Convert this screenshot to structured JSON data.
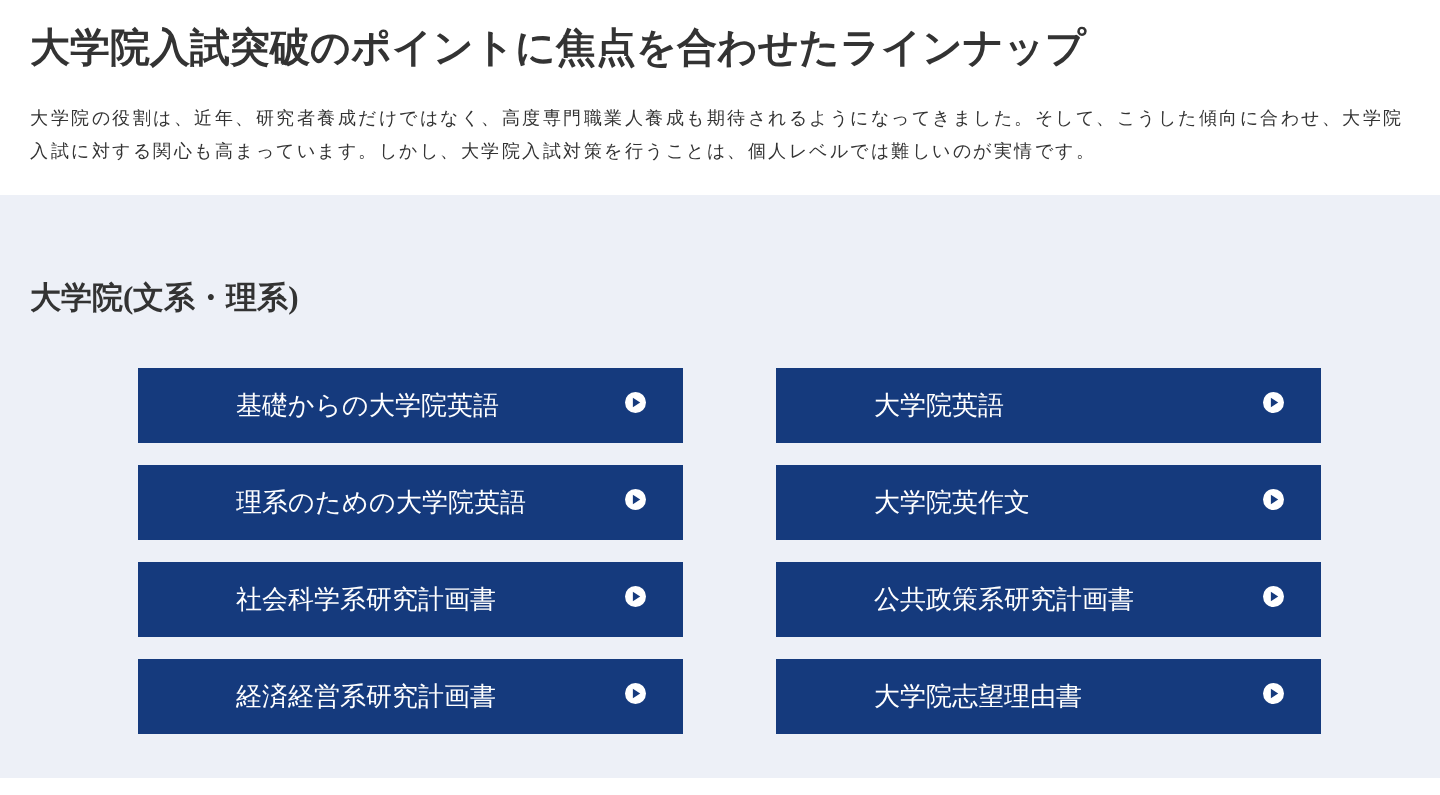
{
  "header": {
    "title": "大学院入試突破のポイントに焦点を合わせたラインナップ",
    "paragraph": "大学院の役割は、近年、研究者養成だけではなく、高度専門職業人養成も期待されるようになってきました。そして、こうした傾向に合わせ、大学院入試に対する関心も高まっています。しかし、大学院入試対策を行うことは、個人レベルでは難しいのが実情です。"
  },
  "section": {
    "heading": "大学院(文系・理系)",
    "links": [
      {
        "label": "基礎からの大学院英語"
      },
      {
        "label": "大学院英語"
      },
      {
        "label": "理系のための大学院英語"
      },
      {
        "label": "大学院英作文"
      },
      {
        "label": "社会科学系研究計画書"
      },
      {
        "label": "公共政策系研究計画書"
      },
      {
        "label": "経済経営系研究計画書"
      },
      {
        "label": "大学院志望理由書"
      }
    ]
  }
}
